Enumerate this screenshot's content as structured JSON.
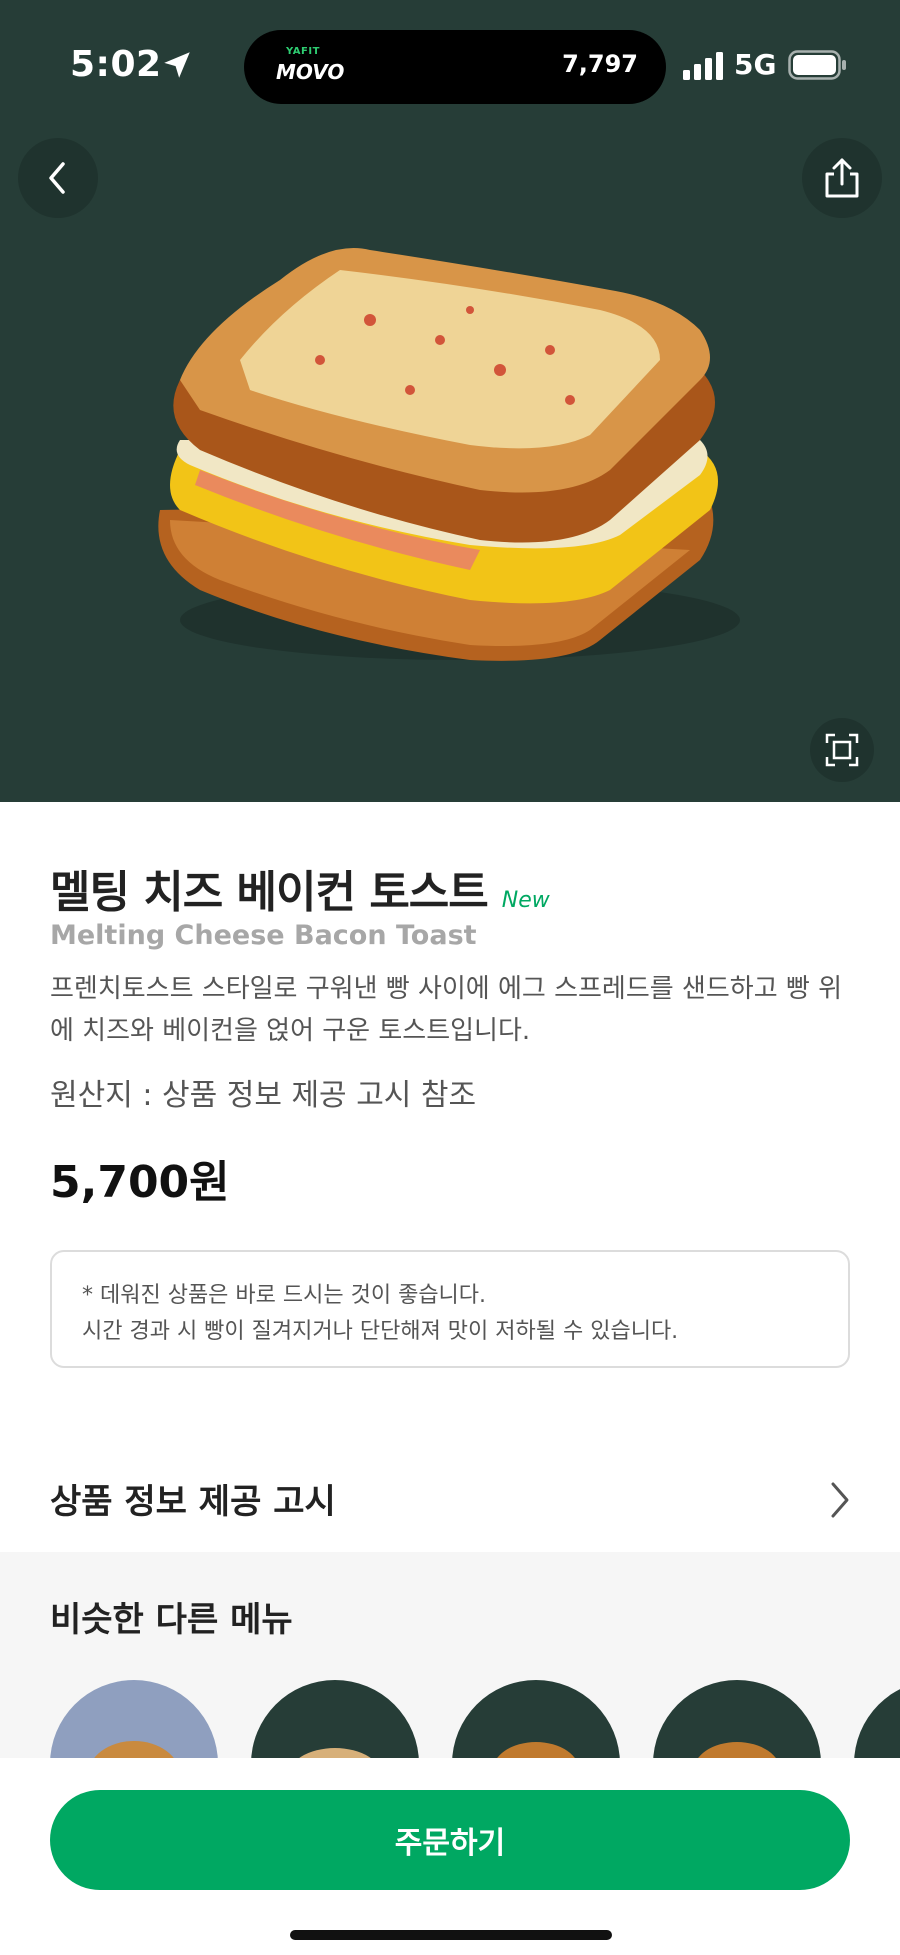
{
  "status_bar": {
    "time": "5:02",
    "island_brand_small": "YAFIT",
    "island_brand": "MOVO",
    "step_count": "7,797",
    "network": "5G"
  },
  "product": {
    "name_ko": "멜팅 치즈 베이컨 토스트",
    "badge": "New",
    "name_en": "Melting Cheese Bacon Toast",
    "description": "프렌치토스트 스타일로 구워낸 빵 사이에 에그 스프레드를 샌드하고 빵 위에 치즈와 베이컨을 얹어 구운 토스트입니다.",
    "origin": "원산지 : 상품 정보 제공 고시 참조",
    "price": "5,700원",
    "notice_line1": "* 데워진 상품은 바로 드시는 것이 좋습니다.",
    "notice_line2": "시간 경과 시 빵이 질겨지거나 단단해져 맛이 저하될 수 있습니다."
  },
  "info_link": {
    "label": "상품 정보 제공 고시"
  },
  "similar": {
    "title": "비슷한 다른 메뉴"
  },
  "order_button": {
    "label": "주문하기"
  },
  "colors": {
    "hero_bg": "#263d37",
    "accent": "#00a862"
  },
  "icons": [
    "back-icon",
    "share-icon",
    "zoom-icon",
    "chevron-right-icon",
    "location-arrow-icon",
    "signal-icon",
    "battery-icon"
  ]
}
